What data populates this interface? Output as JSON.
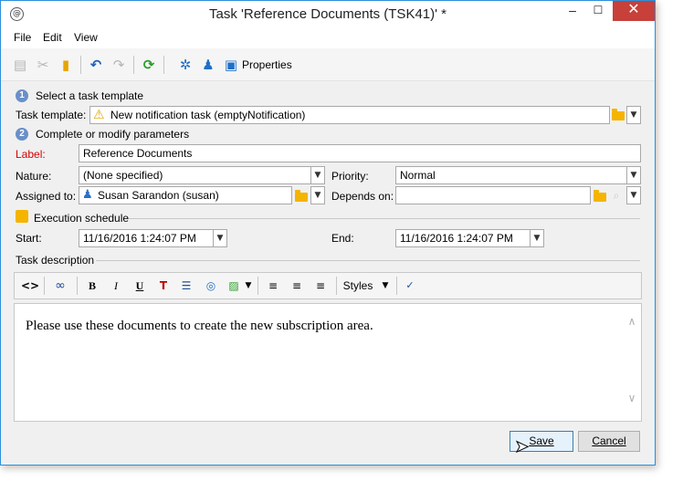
{
  "window": {
    "title": "Task 'Reference Documents (TSK41)' *",
    "app_icon": "@",
    "min_glyph": "–",
    "max_glyph": "☐",
    "close_glyph": "✕"
  },
  "menu": [
    "File",
    "Edit",
    "View"
  ],
  "toolbar": {
    "properties_label": "Properties",
    "icons": [
      "paste-icon",
      "cut-icon",
      "clipboard-icon",
      "undo-icon",
      "redo-icon",
      "refresh-icon",
      "settings-icon",
      "users-icon",
      "properties-icon"
    ]
  },
  "step1": {
    "number": "1",
    "heading": "Select a task template",
    "template_label": "Task template:",
    "template_value": "New notification task (emptyNotification)"
  },
  "step2": {
    "number": "2",
    "heading": "Complete or modify parameters",
    "label_label": "Label:",
    "label_value": "Reference Documents",
    "nature_label": "Nature:",
    "nature_value": "(None specified)",
    "priority_label": "Priority:",
    "priority_value": "Normal",
    "assigned_label": "Assigned to:",
    "assigned_value": "Susan Sarandon (susan)",
    "depends_label": "Depends on:",
    "depends_value": ""
  },
  "schedule": {
    "heading": "Execution schedule",
    "start_label": "Start:",
    "start_value": "11/16/2016 1:24:07 PM",
    "end_label": "End:",
    "end_value": "11/16/2016 1:24:07 PM"
  },
  "description": {
    "heading": "Task description",
    "styles_label": "Styles",
    "bold": "B",
    "italic": "I",
    "underline": "U",
    "text": "Please use these documents to create the new subscription area."
  },
  "buttons": {
    "save": "Save",
    "cancel": "Cancel"
  },
  "colors": {
    "close_button": "#c7403a",
    "label_required": "#d40000",
    "step_badge": "#6a8fc8",
    "folder": "#f4b400"
  }
}
